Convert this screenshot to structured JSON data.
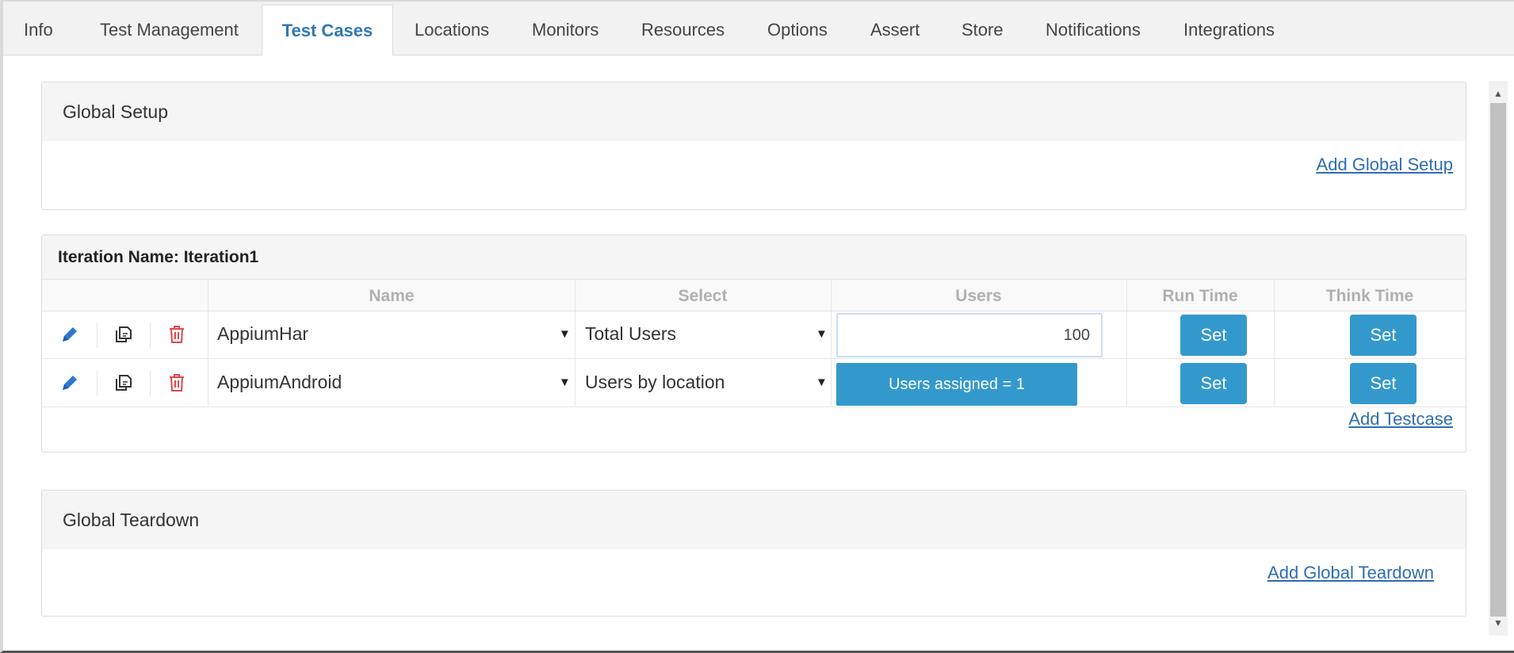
{
  "tabs": [
    {
      "label": "Info"
    },
    {
      "label": "Test Management"
    },
    {
      "label": "Test Cases"
    },
    {
      "label": "Locations"
    },
    {
      "label": "Monitors"
    },
    {
      "label": "Resources"
    },
    {
      "label": "Options"
    },
    {
      "label": "Assert"
    },
    {
      "label": "Store"
    },
    {
      "label": "Notifications"
    },
    {
      "label": "Integrations"
    }
  ],
  "active_tab": "Test Cases",
  "global_setup": {
    "title": "Global Setup",
    "add_link": "Add Global Setup"
  },
  "iteration": {
    "title": "Iteration Name: Iteration1",
    "columns": {
      "name": "Name",
      "select": "Select",
      "users": "Users",
      "run_time": "Run Time",
      "think_time": "Think Time"
    },
    "rows": [
      {
        "name": "AppiumHar",
        "select": "Total Users",
        "users_value": "100",
        "run_time_button": "Set",
        "think_time_button": "Set"
      },
      {
        "name": "AppiumAndroid",
        "select": "Users by location",
        "users_assigned": "Users assigned = 1",
        "run_time_button": "Set",
        "think_time_button": "Set"
      }
    ],
    "add_link": "Add Testcase"
  },
  "global_teardown": {
    "title": "Global Teardown",
    "add_link": "Add Global Teardown"
  },
  "icons": {
    "edit": "pencil-icon",
    "copy": "copy-icon",
    "delete": "trash-icon",
    "dropdown": "caret-down-icon"
  },
  "colors": {
    "accent": "#3399cc",
    "active_tab_text": "#2f77b6",
    "link": "#2f6db0",
    "edit_icon": "#2f77d0",
    "delete_icon": "#e04848"
  }
}
